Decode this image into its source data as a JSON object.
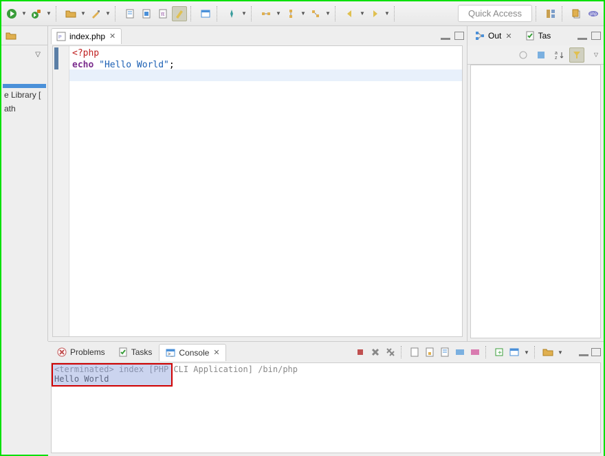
{
  "toolbar": {
    "quick_access": "Quick Access"
  },
  "left_panel": {
    "items": [
      {
        "label": ""
      },
      {
        "label": "e Library ["
      },
      {
        "label": "ath"
      }
    ]
  },
  "editor": {
    "tab_label": "index.php",
    "code": {
      "l1_open": "<?php",
      "l2_kw": "echo",
      "l2_sp": " ",
      "l2_str": "\"Hello World\"",
      "l2_end": ";"
    }
  },
  "outline": {
    "tab1": "Out",
    "tab2": "Tas"
  },
  "bottom": {
    "tabs": {
      "problems": "Problems",
      "tasks": "Tasks",
      "console": "Console"
    },
    "console": {
      "status": "<terminated> index [PHP CLI Application] /bin/php",
      "output": "Hello World"
    }
  }
}
